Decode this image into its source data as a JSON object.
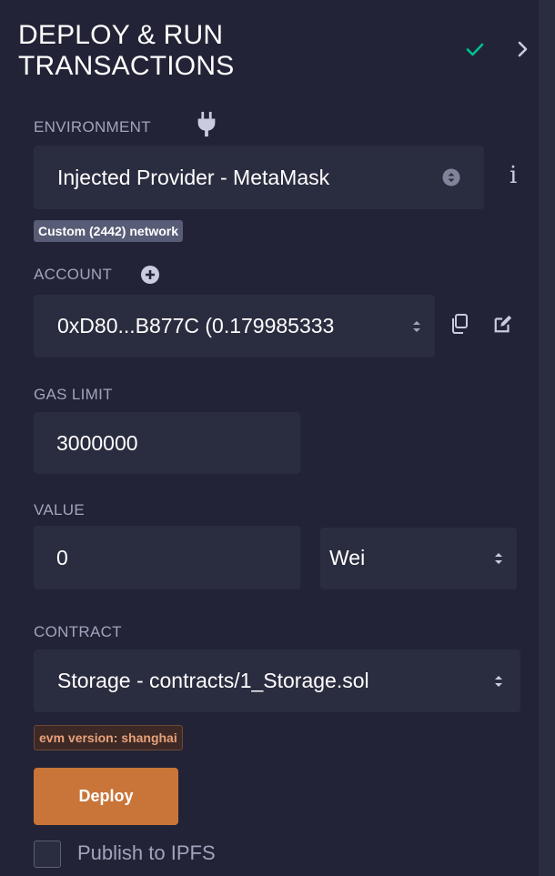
{
  "header": {
    "title_line1": "DEPLOY & RUN",
    "title_line2": "TRANSACTIONS"
  },
  "environment": {
    "label": "ENVIRONMENT",
    "value": "Injected Provider - MetaMask",
    "network_badge": "Custom (2442) network",
    "info_label": "i"
  },
  "account": {
    "label": "ACCOUNT",
    "value": "0xD80...B877C (0.179985333"
  },
  "gas_limit": {
    "label": "GAS LIMIT",
    "value": "3000000"
  },
  "value": {
    "label": "VALUE",
    "amount": "0",
    "unit": "Wei"
  },
  "contract": {
    "label": "CONTRACT",
    "value": "Storage - contracts/1_Storage.sol",
    "evm_badge": "evm version: shanghai"
  },
  "deploy": {
    "button_label": "Deploy"
  },
  "publish": {
    "label": "Publish to IPFS",
    "checked": false
  },
  "colors": {
    "background": "#222336",
    "field": "#2a2c3f",
    "deploy": "#c97539",
    "check": "#00c28b"
  },
  "icons": [
    "check-icon",
    "chevron-right-icon",
    "plug-icon",
    "info-icon",
    "plus-circle-icon",
    "copy-icon",
    "edit-icon",
    "stepper-icon"
  ]
}
